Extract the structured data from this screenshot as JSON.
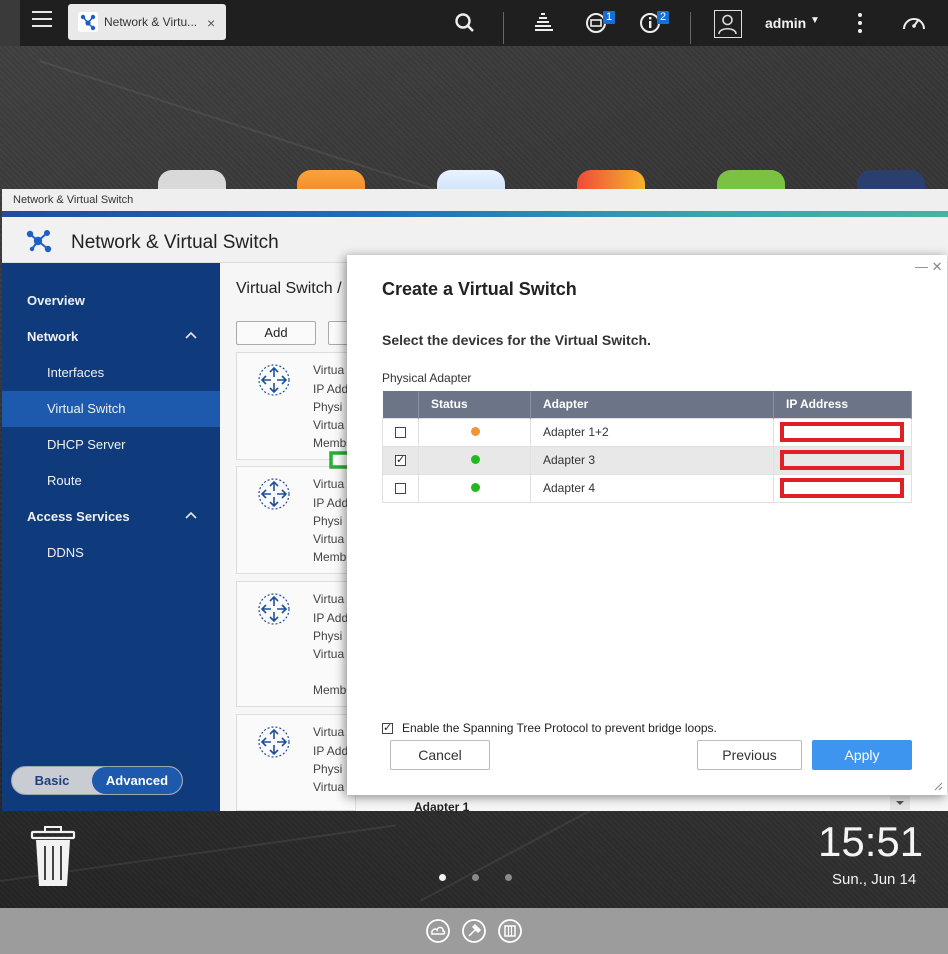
{
  "topbar": {
    "tab_label": "Network & Virtu...",
    "tab_close": "×",
    "badge_tasks": "1",
    "badge_info": "2",
    "user_name": "admin",
    "user_caret": "▼"
  },
  "app": {
    "titlebar": "Network & Virtual Switch",
    "header_title": "Network & Virtual Switch"
  },
  "sidebar": {
    "items": [
      {
        "label": "Overview"
      },
      {
        "label": "Network"
      },
      {
        "label": "Interfaces"
      },
      {
        "label": "Virtual Switch"
      },
      {
        "label": "DHCP Server"
      },
      {
        "label": "Route"
      },
      {
        "label": "Access Services"
      },
      {
        "label": "DDNS"
      }
    ],
    "mode_basic": "Basic",
    "mode_advanced": "Advanced"
  },
  "content": {
    "breadcrumb": "Virtual Switch /",
    "add_button": "Add",
    "cards": [
      {
        "lines": [
          "Virtua",
          "IP Add",
          "Physi",
          "Virtua",
          "Memb"
        ]
      },
      {
        "lines": [
          "Virtua",
          "IP Add",
          "Physi",
          "Virtua",
          "Memb"
        ]
      },
      {
        "lines": [
          "Virtua",
          "IP Add",
          "Physi",
          "Virtua",
          "Memb"
        ]
      },
      {
        "lines": [
          "Virtua",
          "IP Add",
          "Physi",
          "Virtua"
        ]
      }
    ],
    "bottom_row": "Adapter 1"
  },
  "modal": {
    "window_controls": "— ✕",
    "title": "Create a Virtual Switch",
    "subtitle": "Select the devices for the Virtual Switch.",
    "group_label": "Physical Adapter",
    "columns": [
      "",
      "Status",
      "Adapter",
      "IP Address"
    ],
    "rows": [
      {
        "checked": false,
        "status_color": "#f0953a",
        "adapter": "Adapter 1+2"
      },
      {
        "checked": true,
        "status_color": "#22b81e",
        "adapter": "Adapter 3"
      },
      {
        "checked": false,
        "status_color": "#22b81e",
        "adapter": "Adapter 4"
      }
    ],
    "stp_label": "Enable the Spanning Tree Protocol to prevent bridge loops.",
    "stp_checked": true,
    "cancel": "Cancel",
    "previous": "Previous",
    "apply": "Apply"
  },
  "desktop": {
    "time": "15:51",
    "date": "Sun., Jun 14"
  },
  "colors": {
    "accent": "#3d95ef",
    "sidebar": "#0f3b7d",
    "sidebar_active": "#1d59ad",
    "redaction": "#e01f26",
    "arrow": "#27b034"
  }
}
